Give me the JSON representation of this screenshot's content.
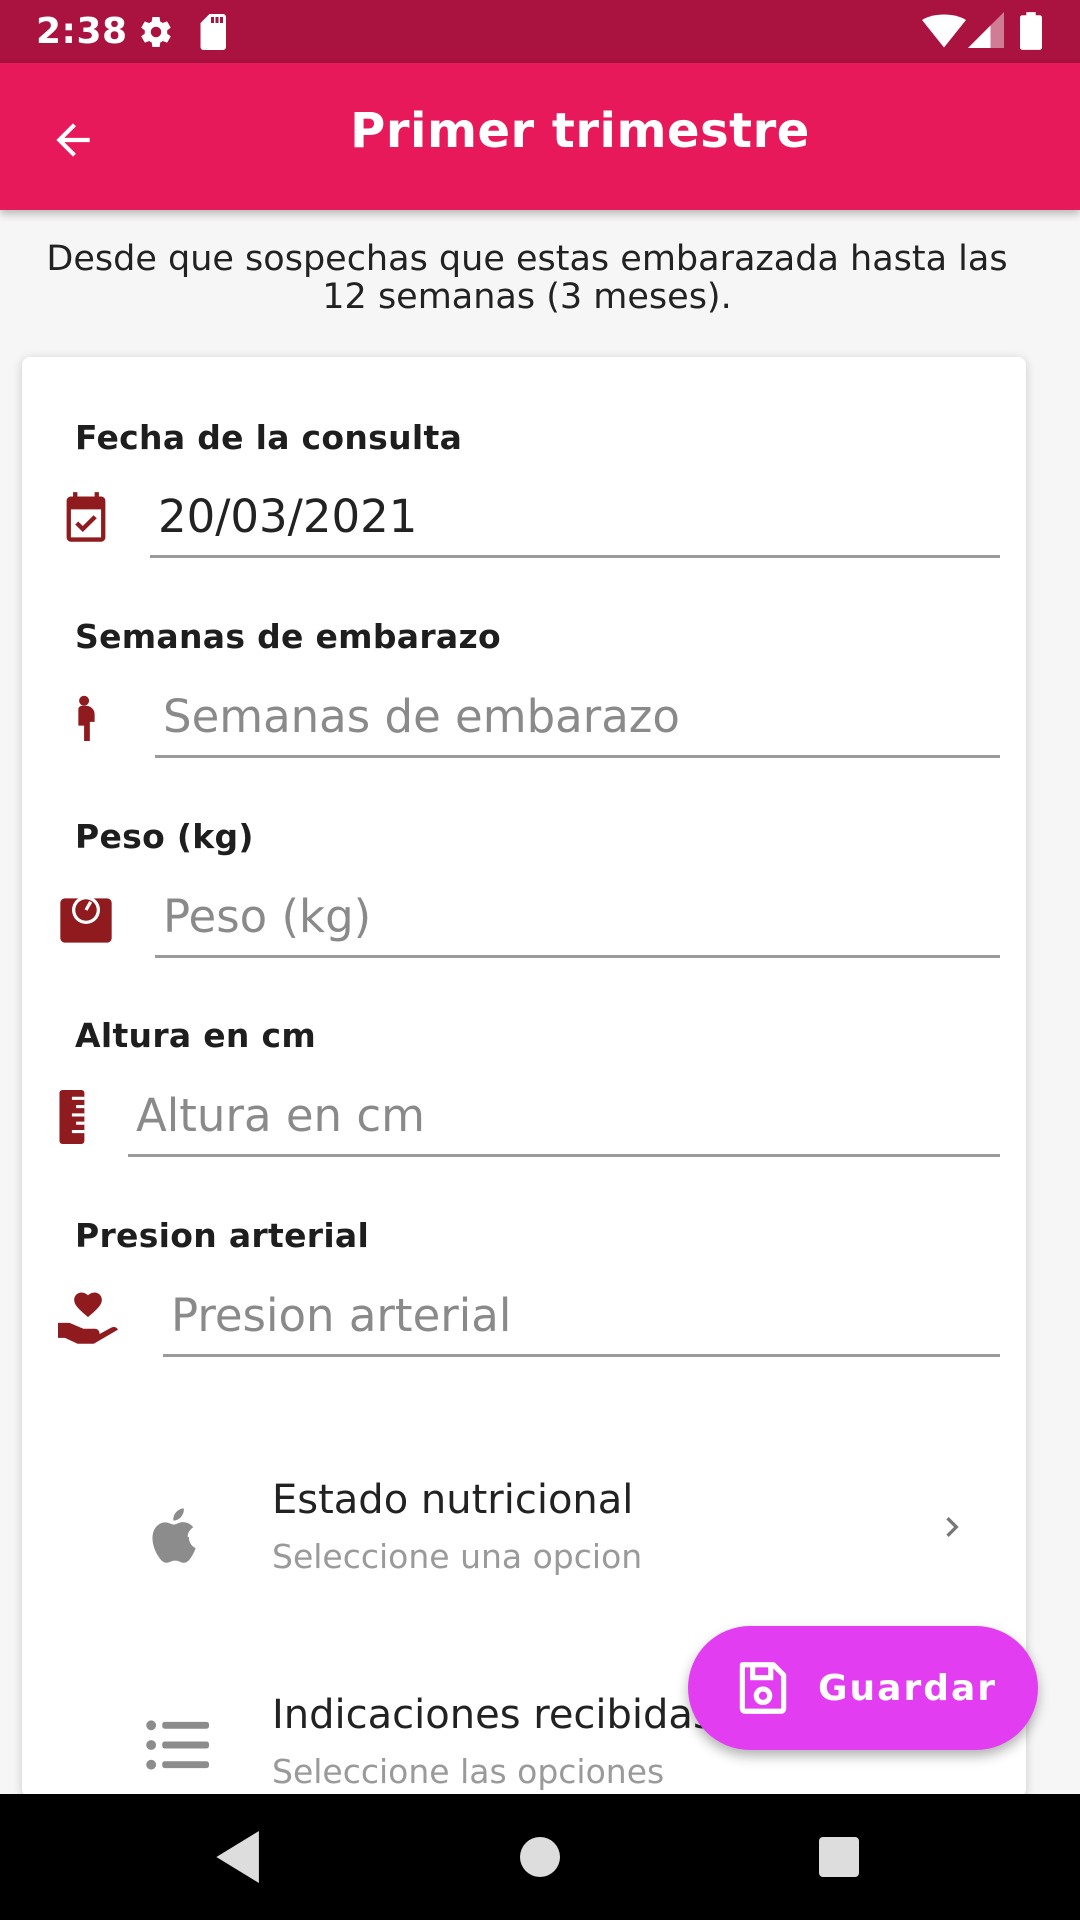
{
  "status_bar": {
    "time": "2:38"
  },
  "app_bar": {
    "title": "Primer trimestre"
  },
  "subtitle": "Desde que sospechas que estas embarazada hasta las 12 semanas (3 meses).",
  "form": {
    "fecha": {
      "label": "Fecha de la consulta",
      "value": "20/03/2021",
      "placeholder": ""
    },
    "semanas": {
      "label": "Semanas de embarazo",
      "value": "",
      "placeholder": "Semanas de embarazo"
    },
    "peso": {
      "label": "Peso (kg)",
      "value": "",
      "placeholder": "Peso (kg)"
    },
    "altura": {
      "label": "Altura en cm",
      "value": "",
      "placeholder": "Altura en cm"
    },
    "presion": {
      "label": "Presion arterial",
      "value": "",
      "placeholder": "Presion arterial"
    }
  },
  "options": [
    {
      "title": "Estado nutricional",
      "subtitle": "Seleccione una opcion"
    },
    {
      "title": "Indicaciones recibidas",
      "subtitle": "Seleccione las opciones"
    }
  ],
  "fab": {
    "label": "Guardar"
  },
  "colors": {
    "status_bar": "#aa123f",
    "app_bar": "#e8195a",
    "icon_accent": "#8f1b1f",
    "fab": "#e23df1"
  }
}
